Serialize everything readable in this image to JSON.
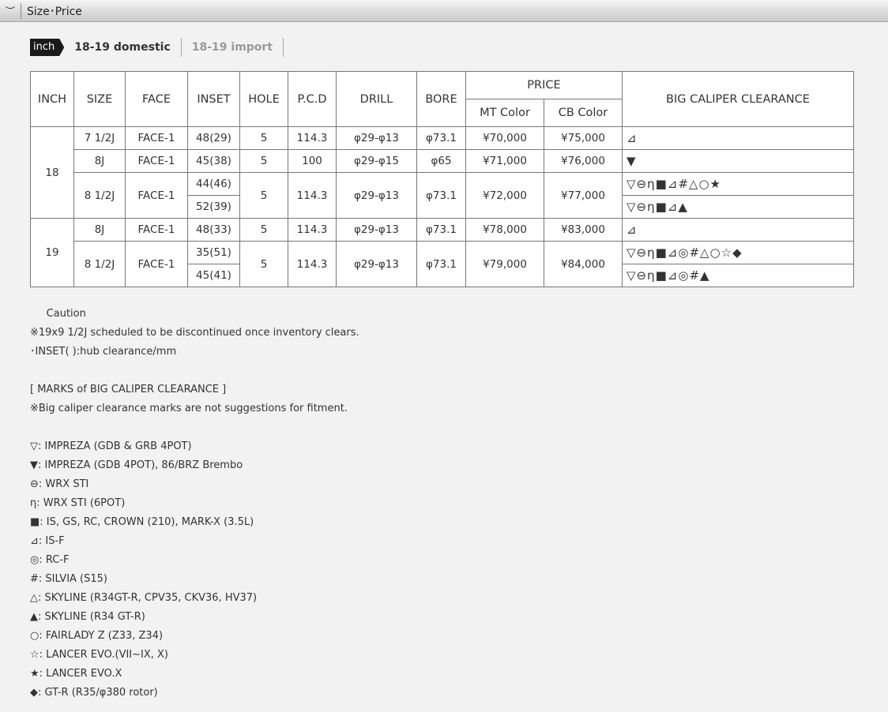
{
  "section": {
    "title": "Size･Price",
    "chevron_icon": "chevron-down-icon"
  },
  "tabs": {
    "unit": "inch",
    "items": [
      "18-19 domestic",
      "18-19 import"
    ]
  },
  "table": {
    "headers": {
      "inch": "INCH",
      "size": "SIZE",
      "face": "FACE",
      "inset": "INSET",
      "hole": "HOLE",
      "pcd": "P.C.D",
      "drill": "DRILL",
      "bore": "BORE",
      "price": "PRICE",
      "mt": "MT Color",
      "cb": "CB Color",
      "clearance": "BIG CALIPER CLEARANCE"
    },
    "groups": [
      {
        "inch": "18",
        "rows": [
          {
            "size": "7 1/2J",
            "face": "FACE-1",
            "insets": [
              "48(29)"
            ],
            "hole": "5",
            "pcd": "114.3",
            "drill": "φ29-φ13",
            "bore": "φ73.1",
            "mt": "¥70,000",
            "cb": "¥75,000",
            "marks": [
              "⊿"
            ]
          },
          {
            "size": "8J",
            "face": "FACE-1",
            "insets": [
              "45(38)"
            ],
            "hole": "5",
            "pcd": "100",
            "drill": "φ29-φ15",
            "bore": "φ65",
            "mt": "¥71,000",
            "cb": "¥76,000",
            "marks": [
              "▼"
            ]
          },
          {
            "size": "8 1/2J",
            "face": "FACE-1",
            "insets": [
              "44(46)",
              "52(39)"
            ],
            "hole": "5",
            "pcd": "114.3",
            "drill": "φ29-φ13",
            "bore": "φ73.1",
            "mt": "¥72,000",
            "cb": "¥77,000",
            "marks": [
              "▽⊖η■⊿#△○★",
              "▽⊖η■⊿▲"
            ]
          }
        ]
      },
      {
        "inch": "19",
        "rows": [
          {
            "size": "8J",
            "face": "FACE-1",
            "insets": [
              "48(33)"
            ],
            "hole": "5",
            "pcd": "114.3",
            "drill": "φ29-φ13",
            "bore": "φ73.1",
            "mt": "¥78,000",
            "cb": "¥83,000",
            "marks": [
              "⊿"
            ]
          },
          {
            "size": "8 1/2J",
            "face": "FACE-1",
            "insets": [
              "35(51)",
              "45(41)"
            ],
            "hole": "5",
            "pcd": "114.3",
            "drill": "φ29-φ13",
            "bore": "φ73.1",
            "mt": "¥79,000",
            "cb": "¥84,000",
            "marks": [
              "▽⊖η■⊿◎#△○☆◆",
              "▽⊖η■⊿◎#▲"
            ]
          }
        ]
      }
    ]
  },
  "notes": [
    "     Caution",
    "※19x9 1/2J scheduled to be discontinued once inventory clears.",
    "･INSET( ):hub clearance/mm",
    "",
    "[ MARKS of BIG CALIPER CLEARANCE ]",
    "※Big caliper clearance marks are not suggestions for fitment.",
    "",
    "▽: IMPREZA (GDB & GRB 4POT)",
    "▼: IMPREZA (GDB 4POT), 86/BRZ Brembo",
    "⊖: WRX STI",
    "η: WRX STI (6POT)",
    "■: IS, GS, RC, CROWN (210), MARK-X (3.5L)",
    "⊿: IS-F",
    "◎: RC-F",
    "#: SILVIA (S15)",
    "△: SKYLINE (R34GT-R, CPV35, CKV36, HV37)",
    "▲: SKYLINE (R34 GT-R)",
    "○: FAIRLADY Z (Z33, Z34)",
    "☆: LANCER EVO.(VII~IX, X)",
    "★: LANCER EVO.X",
    "◆: GT-R (R35/φ380 rotor)"
  ]
}
